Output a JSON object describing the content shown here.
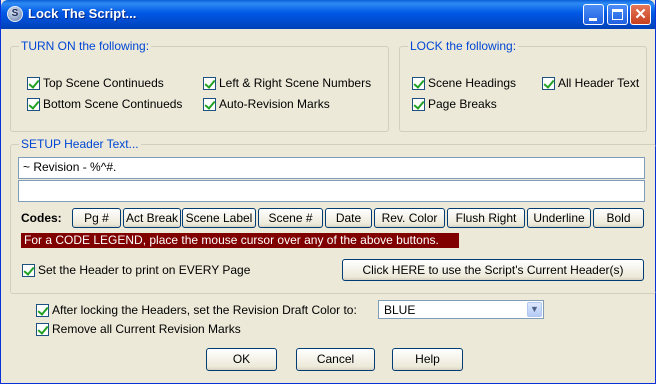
{
  "window": {
    "title": "Lock The Script..."
  },
  "turn_on": {
    "legend": "TURN ON the following:",
    "items": [
      {
        "label": "Top Scene Continueds",
        "checked": true
      },
      {
        "label": "Left & Right Scene Numbers",
        "checked": true
      },
      {
        "label": "Bottom Scene Continueds",
        "checked": true
      },
      {
        "label": "Auto-Revision Marks",
        "checked": true
      }
    ]
  },
  "lock": {
    "legend": "LOCK the following:",
    "items": [
      {
        "label": "Scene Headings",
        "checked": true
      },
      {
        "label": "All Header Text",
        "checked": true
      },
      {
        "label": "Page Breaks",
        "checked": true
      }
    ]
  },
  "header": {
    "legend": "SETUP Header Text...",
    "line1": "~ Revision  -  %^#.",
    "line2": "",
    "codes_label": "Codes:",
    "code_buttons": [
      "Pg #",
      "Act Break",
      "Scene Label",
      "Scene #",
      "Date",
      "Rev. Color",
      "Flush Right",
      "Underline",
      "Bold"
    ],
    "legend_hint": "For a CODE LEGEND, place the mouse cursor over any of the above buttons.",
    "every_page": {
      "label": "Set the Header to print on EVERY Page",
      "checked": true
    },
    "use_current_button": "Click HERE to use the Script's Current Header(s)"
  },
  "bottom": {
    "set_color": {
      "label": "After locking the Headers, set the Revision Draft Color to:",
      "checked": true
    },
    "color_value": "BLUE",
    "remove_marks": {
      "label": "Remove all Current Revision Marks",
      "checked": true
    }
  },
  "buttons": {
    "ok": "OK",
    "cancel": "Cancel",
    "help": "Help"
  },
  "colors": {
    "title_bar": "#0058e6",
    "group_title": "#0046d5",
    "legend_bar": "#800000",
    "face": "#ece9d8"
  }
}
